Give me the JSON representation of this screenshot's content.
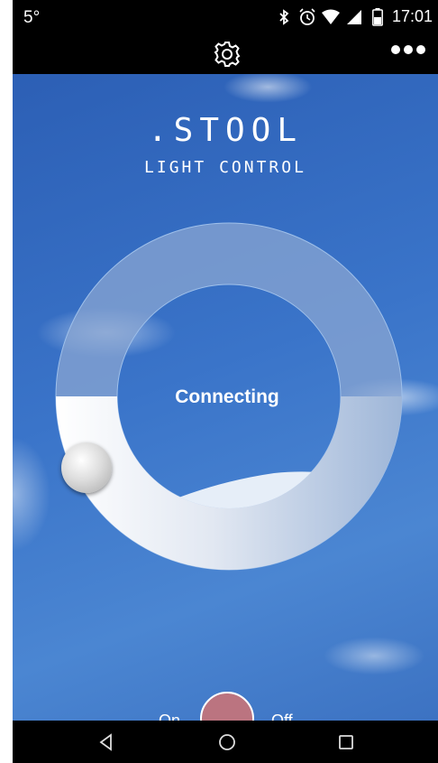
{
  "status_bar": {
    "temperature": "5°",
    "time": "17:01",
    "icons": [
      "bluetooth-icon",
      "alarm-icon",
      "wifi-icon",
      "cell-signal-icon",
      "battery-icon"
    ]
  },
  "app_bar": {
    "icons": [
      "gear-icon",
      "overflow-menu-icon"
    ]
  },
  "header": {
    "title": ".STOOL",
    "subtitle": "LIGHT CONTROL"
  },
  "dial": {
    "status": "Connecting",
    "level_fraction": 0.5
  },
  "power": {
    "on_label": "On",
    "off_label": "Off",
    "state_color": "#bb7480"
  },
  "nav_bar": {
    "icons": [
      "back-icon",
      "home-icon",
      "recents-icon"
    ]
  },
  "colors": {
    "sky": "#3a74c9",
    "ring_track": "#7f9fd0",
    "ring_fill": "#ffffff"
  }
}
